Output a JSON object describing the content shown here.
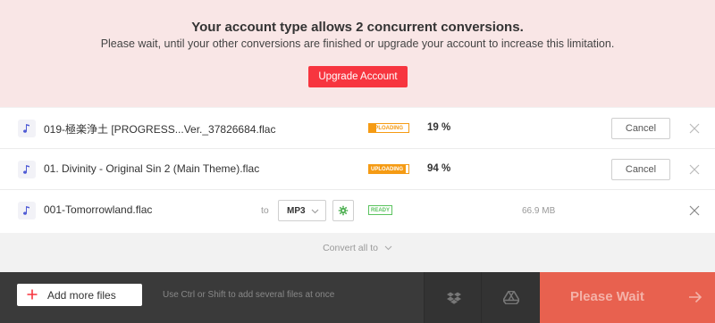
{
  "banner": {
    "title": "Your account type allows 2 concurrent conversions.",
    "message": "Please wait, until your other conversions are finished or upgrade your account to increase this limitation.",
    "upgrade_label": "Upgrade Account",
    "upgrade_color": "#f7353f",
    "background": "#f9e6e6"
  },
  "files": [
    {
      "name": "019-極楽浄土 [PROGRESS...Ver._37826684.flac",
      "status": "UPLOADING",
      "progress": 0.19,
      "percent": "19 %",
      "cancel_label": "Cancel",
      "icon": "music-note-icon"
    },
    {
      "name": "01. Divinity - Original Sin 2 (Main Theme).flac",
      "status": "UPLOADING",
      "progress": 0.94,
      "percent": "94 %",
      "cancel_label": "Cancel",
      "icon": "music-note-icon"
    },
    {
      "name": "001-Tomorrowland.flac",
      "to_label": "to",
      "format": "MP3",
      "status": "READY",
      "size": "66.9 MB",
      "icon": "music-note-icon"
    }
  ],
  "convert_all_label": "Convert all to",
  "footer": {
    "add_files_label": "Add more files",
    "hint": "Use Ctrl or Shift to add several files at once",
    "wait_label": "Please Wait",
    "wait_color": "#e8614f"
  },
  "colors": {
    "uploading": "#f59b14",
    "ready": "#5bc35f",
    "accent": "#f7353f"
  }
}
